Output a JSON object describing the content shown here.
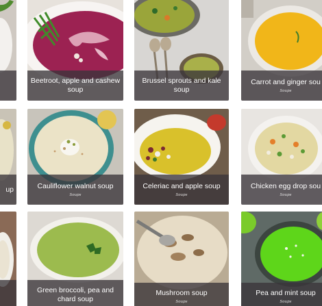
{
  "recipes": [
    {
      "title": "Beetroot, apple and cashew soup",
      "category": ""
    },
    {
      "title": "Brussel sprouts and kale soup",
      "category": ""
    },
    {
      "title": "Carrot and ginger sou",
      "category": "Soups"
    },
    {
      "title": "Cauliflower walnut soup",
      "category": "Soups"
    },
    {
      "title": "Celeriac and apple soup",
      "category": "Soups"
    },
    {
      "title": "Chicken egg drop sou",
      "category": "Soups"
    },
    {
      "title": "Green broccoli, pea and chard soup",
      "category": ""
    },
    {
      "title": "Mushroom soup",
      "category": "Soups"
    },
    {
      "title": "Pea and mint soup",
      "category": "Soups"
    }
  ],
  "left_column_fragments": [
    "up"
  ]
}
